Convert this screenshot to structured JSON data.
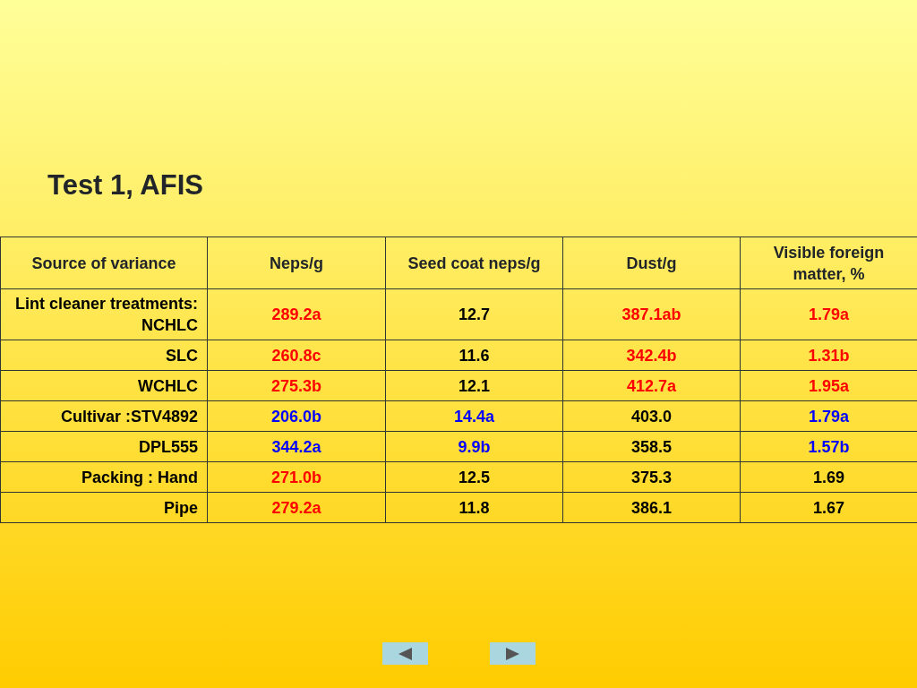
{
  "title": "Test 1, AFIS",
  "table": {
    "columns": [
      "Source of variance",
      "Neps/g",
      "Seed coat neps/g",
      "Dust/g",
      "Visible foreign matter, %"
    ],
    "rows": [
      [
        {
          "text": "Lint cleaner treatments: NCHLC",
          "color": "#000000"
        },
        {
          "text": "289.2a",
          "color": "#ff0000"
        },
        {
          "text": "12.7",
          "color": "#000000"
        },
        {
          "text": "387.1ab",
          "color": "#ff0000"
        },
        {
          "text": "1.79a",
          "color": "#ff0000"
        }
      ],
      [
        {
          "text": "SLC",
          "color": "#000000"
        },
        {
          "text": "260.8c",
          "color": "#ff0000"
        },
        {
          "text": "11.6",
          "color": "#000000"
        },
        {
          "text": "342.4b",
          "color": "#ff0000"
        },
        {
          "text": "1.31b",
          "color": "#ff0000"
        }
      ],
      [
        {
          "text": "WCHLC",
          "color": "#000000"
        },
        {
          "text": "275.3b",
          "color": "#ff0000"
        },
        {
          "text": "12.1",
          "color": "#000000"
        },
        {
          "text": "412.7a",
          "color": "#ff0000"
        },
        {
          "text": "1.95a",
          "color": "#ff0000"
        }
      ],
      [
        {
          "text": "Cultivar :STV4892",
          "color": "#000000"
        },
        {
          "text": "206.0b",
          "color": "#0000ff"
        },
        {
          "text": "14.4a",
          "color": "#0000ff"
        },
        {
          "text": "403.0",
          "color": "#000000"
        },
        {
          "text": "1.79a",
          "color": "#0000ff"
        }
      ],
      [
        {
          "text": "DPL555",
          "color": "#000000"
        },
        {
          "text": "344.2a",
          "color": "#0000ff"
        },
        {
          "text": "9.9b",
          "color": "#0000ff"
        },
        {
          "text": "358.5",
          "color": "#000000"
        },
        {
          "text": "1.57b",
          "color": "#0000ff"
        }
      ],
      [
        {
          "text": "Packing : Hand",
          "color": "#000000"
        },
        {
          "text": "271.0b",
          "color": "#ff0000"
        },
        {
          "text": "12.5",
          "color": "#000000"
        },
        {
          "text": "375.3",
          "color": "#000000"
        },
        {
          "text": "1.69",
          "color": "#000000"
        }
      ],
      [
        {
          "text": "Pipe",
          "color": "#000000"
        },
        {
          "text": "279.2a",
          "color": "#ff0000"
        },
        {
          "text": "11.8",
          "color": "#000000"
        },
        {
          "text": "386.1",
          "color": "#000000"
        },
        {
          "text": "1.67",
          "color": "#000000"
        }
      ]
    ]
  },
  "nav": [
    {
      "kind": "previous"
    },
    {
      "kind": "next"
    }
  ]
}
